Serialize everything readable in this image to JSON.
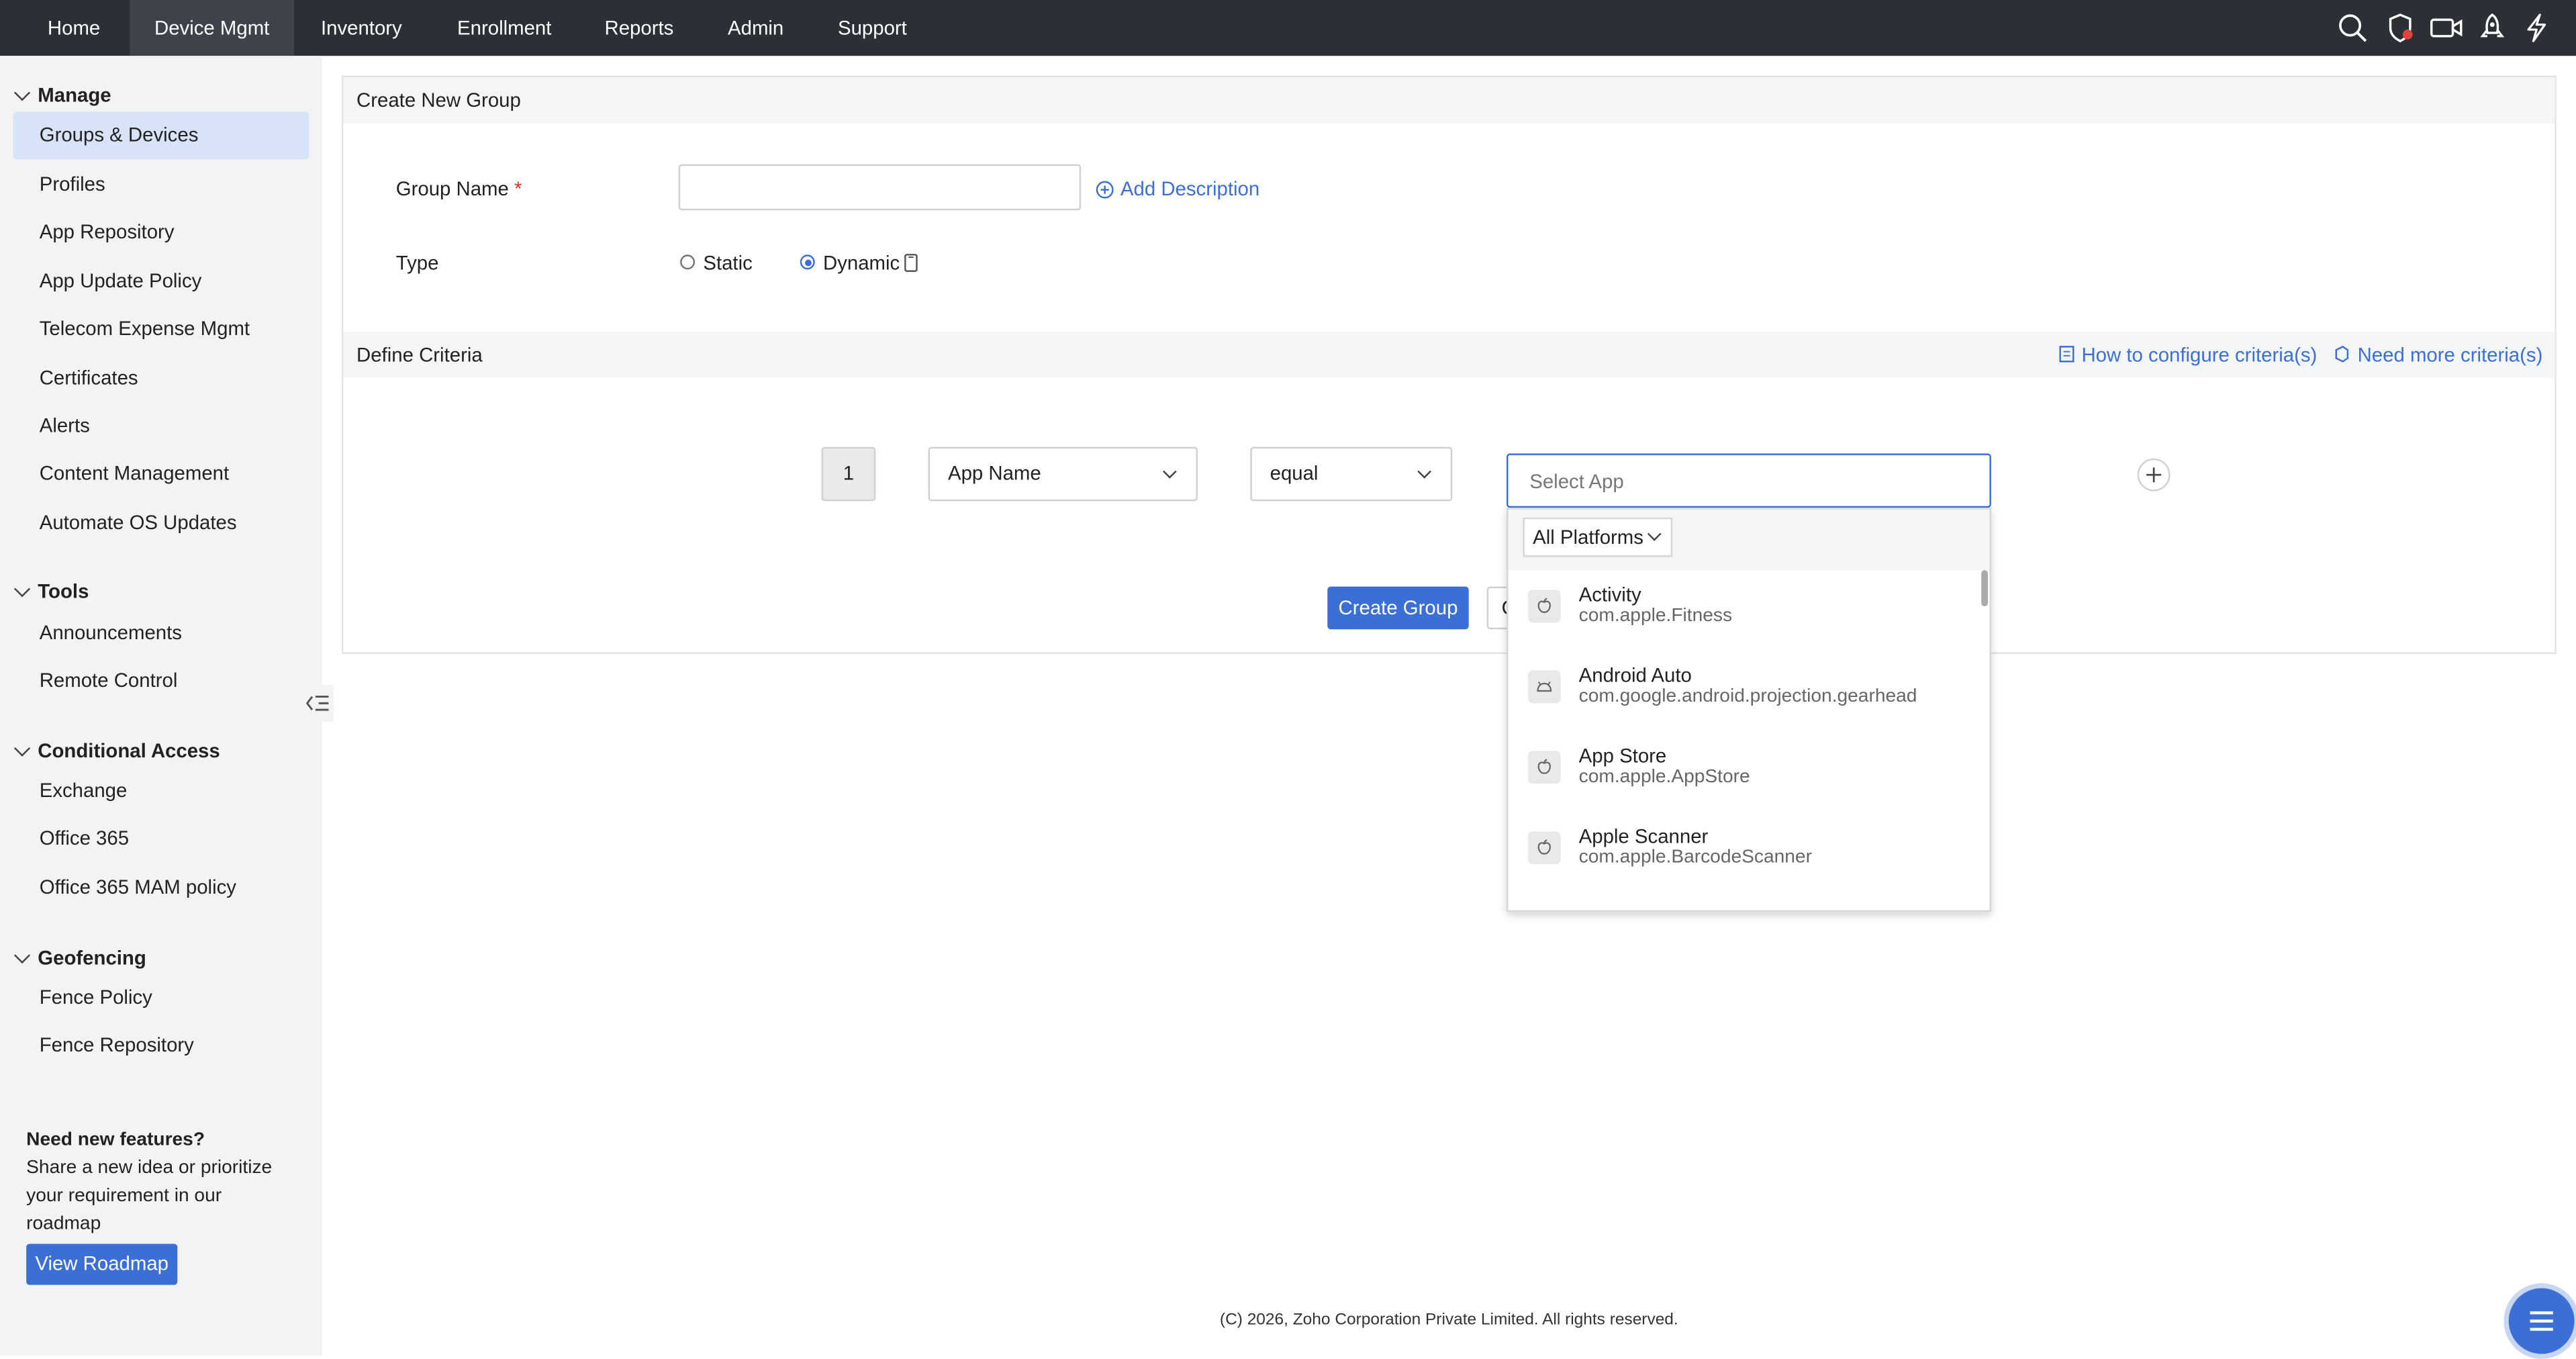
{
  "nav": {
    "items": [
      {
        "label": "Home"
      },
      {
        "label": "Device Mgmt"
      },
      {
        "label": "Inventory"
      },
      {
        "label": "Enrollment"
      },
      {
        "label": "Reports"
      },
      {
        "label": "Admin"
      },
      {
        "label": "Support"
      }
    ],
    "active": "Device Mgmt",
    "icons": [
      "search-icon",
      "shield-alert-icon",
      "video-icon",
      "rocket-icon",
      "lightning-icon"
    ]
  },
  "sidebar": {
    "sections": [
      {
        "title": "Manage",
        "items": [
          "Groups & Devices",
          "Profiles",
          "App Repository",
          "App Update Policy",
          "Telecom Expense Mgmt",
          "Certificates",
          "Alerts",
          "Content Management",
          "Automate OS Updates"
        ]
      },
      {
        "title": "Tools",
        "items": [
          "Announcements",
          "Remote Control"
        ]
      },
      {
        "title": "Conditional Access",
        "items": [
          "Exchange",
          "Office 365",
          "Office 365 MAM policy"
        ]
      },
      {
        "title": "Geofencing",
        "items": [
          "Fence Policy",
          "Fence Repository"
        ]
      }
    ],
    "active_item": "Groups & Devices",
    "promo": {
      "title": "Need new features?",
      "text": "Share a new idea or prioritize your requirement in our roadmap",
      "button": "View Roadmap"
    }
  },
  "form": {
    "header": "Create New Group",
    "group_name_label": "Group Name",
    "required_mark": "*",
    "group_name_value": "",
    "add_description": "Add Description",
    "type_label": "Type",
    "type_options": [
      "Static",
      "Dynamic"
    ],
    "type_selected": "Dynamic"
  },
  "criteria": {
    "header": "Define Criteria",
    "how_to_link": "How to configure criteria(s)",
    "need_more_link": "Need more criteria(s)",
    "row_number": "1",
    "field": "App Name",
    "operator": "equal",
    "value_placeholder": "Select App",
    "value": ""
  },
  "actions": {
    "create": "Create Group",
    "cancel": "C"
  },
  "dropdown": {
    "platform": "All Platforms",
    "apps": [
      {
        "name": "Activity",
        "package": "com.apple.Fitness",
        "platform_icon": "apple-icon"
      },
      {
        "name": "Android Auto",
        "package": "com.google.android.projection.gearhead",
        "platform_icon": "android-icon"
      },
      {
        "name": "App Store",
        "package": "com.apple.AppStore",
        "platform_icon": "apple-icon"
      },
      {
        "name": "Apple Scanner",
        "package": "com.apple.BarcodeScanner",
        "platform_icon": "apple-icon"
      }
    ]
  },
  "footer": "(C) 2026, Zoho Corporation Private Limited. All rights reserved.",
  "colors": {
    "topbar": "#2b2f36",
    "accent": "#3b6fd6",
    "sidebar_bg": "#f2f3f5",
    "active_item_bg": "#d9e3f7"
  }
}
